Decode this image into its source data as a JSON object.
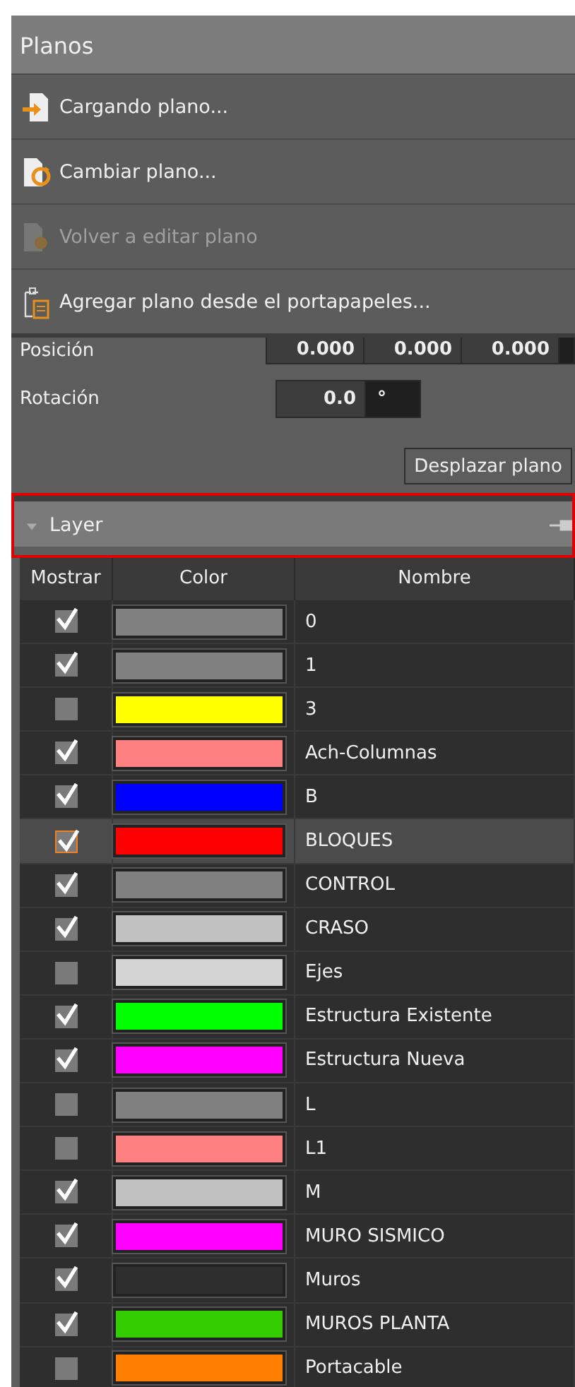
{
  "panel": {
    "title": "Planos"
  },
  "menu": [
    {
      "label": "Cargando plano...",
      "kind": "load",
      "disabled": false
    },
    {
      "label": "Cambiar plano...",
      "kind": "change",
      "disabled": false
    },
    {
      "label": "Volver a editar plano",
      "kind": "edit",
      "disabled": true
    },
    {
      "label": "Agregar plano desde el portapapeles...",
      "kind": "paste",
      "disabled": false
    }
  ],
  "properties": {
    "position": {
      "label": "Posición",
      "values": [
        "0.000",
        "0.000",
        "0.000"
      ]
    },
    "rotation": {
      "label": "Rotación",
      "value": "0.0",
      "unit": "°"
    },
    "button": "Desplazar plano"
  },
  "layer_panel": {
    "title": "Layer",
    "expanded": true,
    "columns": [
      "Mostrar",
      "Color",
      "Nombre"
    ],
    "rows": [
      {
        "show": true,
        "color": "#808080",
        "name": "0",
        "selected": false
      },
      {
        "show": true,
        "color": "#808080",
        "name": "1",
        "selected": false
      },
      {
        "show": false,
        "color": "#ffff00",
        "name": "3",
        "selected": false
      },
      {
        "show": true,
        "color": "#ff8080",
        "name": "Ach-Columnas",
        "selected": false
      },
      {
        "show": true,
        "color": "#0000ff",
        "name": "B",
        "selected": false
      },
      {
        "show": true,
        "color": "#ff0000",
        "name": "BLOQUES",
        "selected": true
      },
      {
        "show": true,
        "color": "#808080",
        "name": "CONTROL",
        "selected": false
      },
      {
        "show": true,
        "color": "#c0c0c0",
        "name": "CRASO",
        "selected": false
      },
      {
        "show": false,
        "color": "#d4d4d4",
        "name": "Ejes",
        "selected": false
      },
      {
        "show": true,
        "color": "#00ff00",
        "name": "Estructura Existente",
        "selected": false
      },
      {
        "show": true,
        "color": "#ff00ff",
        "name": "Estructura Nueva",
        "selected": false
      },
      {
        "show": false,
        "color": "#808080",
        "name": "L",
        "selected": false
      },
      {
        "show": false,
        "color": "#ff8080",
        "name": "L1",
        "selected": false
      },
      {
        "show": true,
        "color": "#c0c0c0",
        "name": "M",
        "selected": false
      },
      {
        "show": true,
        "color": "#ff00ff",
        "name": "MURO SISMICO",
        "selected": false
      },
      {
        "show": true,
        "color": "#2e2e2e",
        "name": "Muros",
        "selected": false
      },
      {
        "show": true,
        "color": "#33cc00",
        "name": "MUROS PLANTA",
        "selected": false
      },
      {
        "show": false,
        "color": "#ff8000",
        "name": "Portacable",
        "selected": false
      }
    ]
  }
}
